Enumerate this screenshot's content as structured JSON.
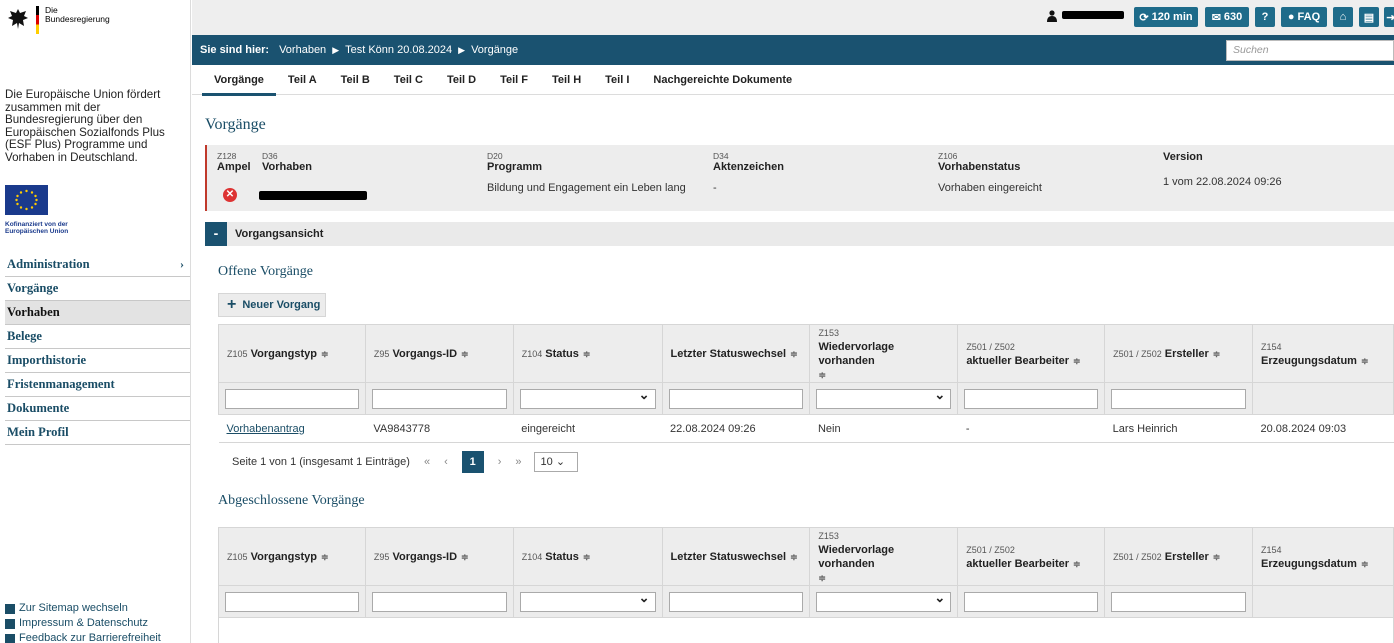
{
  "brand": {
    "line1": "Die",
    "line2": "Bundesregierung"
  },
  "sidebar": {
    "eu_text": "Die Europäische Union fördert zusammen mit der Bundesregierung über den Europäischen Sozialfonds Plus (ESF Plus) Programme und Vorhaben in Deutschland.",
    "eu_caption_1": "Kofinanziert von der",
    "eu_caption_2": "Europäischen Union",
    "nav": [
      {
        "label": "Administration",
        "has_chevron": true
      },
      {
        "label": "Vorgänge"
      },
      {
        "label": "Vorhaben",
        "active": true
      },
      {
        "label": "Belege"
      },
      {
        "label": "Importhistorie"
      },
      {
        "label": "Fristenmanagement"
      },
      {
        "label": "Dokumente"
      },
      {
        "label": "Mein Profil"
      }
    ],
    "chevron": "›",
    "footer": [
      {
        "label": "Zur Sitemap wechseln",
        "icon": "sitemap-icon"
      },
      {
        "label": "Impressum & Datenschutz",
        "icon": "document-icon"
      },
      {
        "label": "Feedback zur Barrierefreiheit",
        "icon": "feedback-icon"
      }
    ]
  },
  "topbar": {
    "timer": "120 min",
    "messages": "630",
    "help": "?",
    "faq": "FAQ",
    "accent": "#1e6b8a"
  },
  "breadcrumb": {
    "lead": "Sie sind hier:",
    "items": [
      "Vorhaben",
      "Test Könn 20.08.2024",
      "Vorgänge"
    ],
    "search_placeholder": "Suchen"
  },
  "tabs": [
    "Vorgänge",
    "Teil A",
    "Teil B",
    "Teil C",
    "Teil D",
    "Teil F",
    "Teil H",
    "Teil I",
    "Nachgereichte Dokumente"
  ],
  "page_title": "Vorgänge",
  "info": {
    "ampel": {
      "code": "Z128",
      "label": "Ampel"
    },
    "vorhaben": {
      "code": "D36",
      "label": "Vorhaben"
    },
    "programm": {
      "code": "D20",
      "label": "Programm",
      "value": "Bildung und Engagement ein Leben lang"
    },
    "aktenzeichen": {
      "code": "D34",
      "label": "Aktenzeichen",
      "value": "-"
    },
    "status": {
      "code": "Z106",
      "label": "Vorhabenstatus",
      "value": "Vorhaben eingereicht"
    },
    "version": {
      "label": "Version",
      "value": "1 vom 22.08.2024 09:26"
    }
  },
  "section": {
    "toggle": "-",
    "title": "Vorgangsansicht"
  },
  "open": {
    "title": "Offene Vorgänge",
    "new_button": "Neuer Vorgang",
    "row": {
      "typ": "Vorhabenantrag",
      "id": "VA9843778",
      "status": "eingereicht",
      "statuswechsel": "22.08.2024 09:26",
      "wiedervorlage": "Nein",
      "bearbeiter": "-",
      "ersteller": "Lars Heinrich",
      "datum": "20.08.2024 09:03"
    },
    "pager_text": "Seite 1 von 1 (insgesamt 1 Einträge)",
    "pager_first": "«",
    "pager_prev": "‹",
    "pager_current": "1",
    "pager_next": "›",
    "pager_last": "»",
    "page_size": "10"
  },
  "closed": {
    "title": "Abgeschlossene Vorgänge"
  },
  "columns": {
    "typ": {
      "code": "Z105",
      "label": "Vorgangstyp"
    },
    "id": {
      "code": "Z95",
      "label": "Vorgangs-ID"
    },
    "status": {
      "code": "Z104",
      "label": "Status"
    },
    "statuswechsel": {
      "label": "Letzter Statuswechsel"
    },
    "wiedervorlage": {
      "code": "Z153",
      "label": "Wiedervorlage vorhanden"
    },
    "bearbeiter": {
      "code": "Z501 / Z502",
      "label": "aktueller Bearbeiter"
    },
    "ersteller": {
      "code": "Z501 / Z502",
      "label": "Ersteller"
    },
    "datum": {
      "code": "Z154",
      "label": "Erzeugungsdatum"
    }
  },
  "sort_glyph": "≑"
}
